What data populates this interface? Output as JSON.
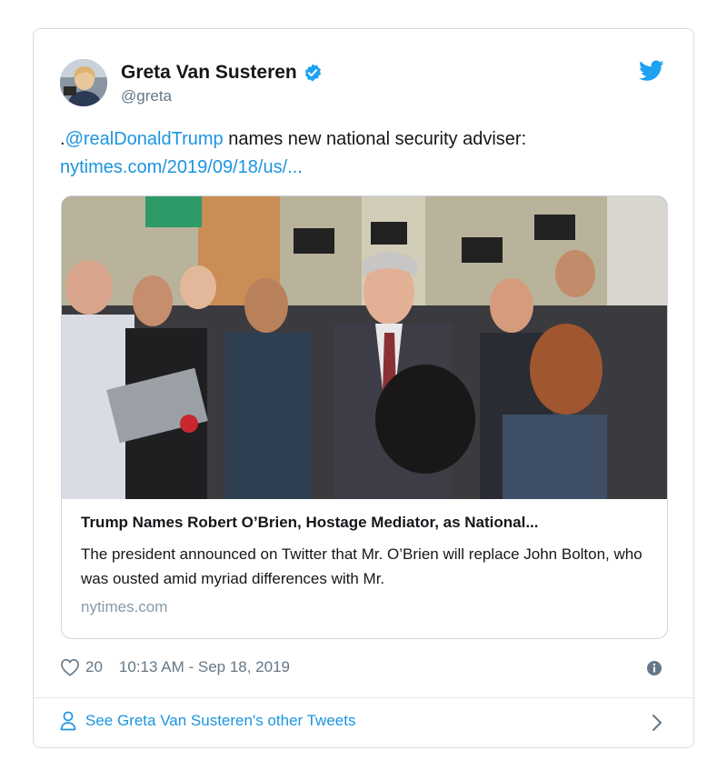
{
  "author": {
    "name": "Greta Van Susteren",
    "handle": "@greta",
    "verified": true
  },
  "tweet": {
    "prefix": ".",
    "mention": "@realDonaldTrump",
    "text": " names new national security adviser:",
    "link": "nytimes.com/2019/09/18/us/..."
  },
  "card": {
    "title": "Trump Names Robert O’Brien, Hostage Mediator, as National...",
    "description": "The president announced on Twitter that Mr. O’Brien will replace John Bolton, who was ousted amid myriad differences with Mr.",
    "domain": "nytimes.com"
  },
  "meta": {
    "likes": "20",
    "timestamp": "10:13 AM - Sep 18, 2019"
  },
  "footer": {
    "label": "See Greta Van Susteren's other Tweets"
  },
  "icons": {
    "verified": "verified-badge-icon",
    "bird": "twitter-bird-icon",
    "heart": "heart-icon",
    "info": "info-icon",
    "person": "person-icon",
    "chevron": "chevron-right-icon"
  },
  "colors": {
    "link": "#1b95e0",
    "text": "#14171a",
    "muted": "#657786",
    "border": "#ccd6dd"
  }
}
